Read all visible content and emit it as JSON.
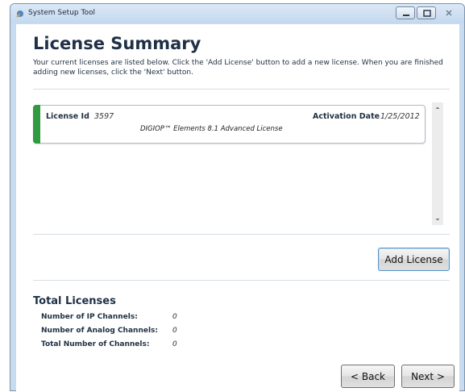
{
  "window": {
    "title": "System Setup Tool",
    "controls": {
      "minimize": "minimize",
      "maximize": "maximize",
      "close": "close"
    }
  },
  "header": {
    "title": "License Summary",
    "description": "Your current licenses are listed below. Click the 'Add License' button to add a new license. When you are finished adding new licenses, click the 'Next' button."
  },
  "licenses": [
    {
      "id_label": "License Id",
      "id_value": "3597",
      "activation_label": "Activation Date",
      "activation_value": "1/25/2012",
      "name": "DIGIOP™ Elements 8.1 Advanced License",
      "status_color": "#2f9b3e"
    }
  ],
  "actions": {
    "add_license": "Add License"
  },
  "totals": {
    "heading": "Total Licenses",
    "rows": [
      {
        "label": "Number of IP Channels:",
        "value": "0"
      },
      {
        "label": "Number of Analog Channels:",
        "value": "0"
      },
      {
        "label": "Total Number of Channels:",
        "value": "0"
      }
    ]
  },
  "nav": {
    "back": "< Back",
    "next": "Next >"
  }
}
